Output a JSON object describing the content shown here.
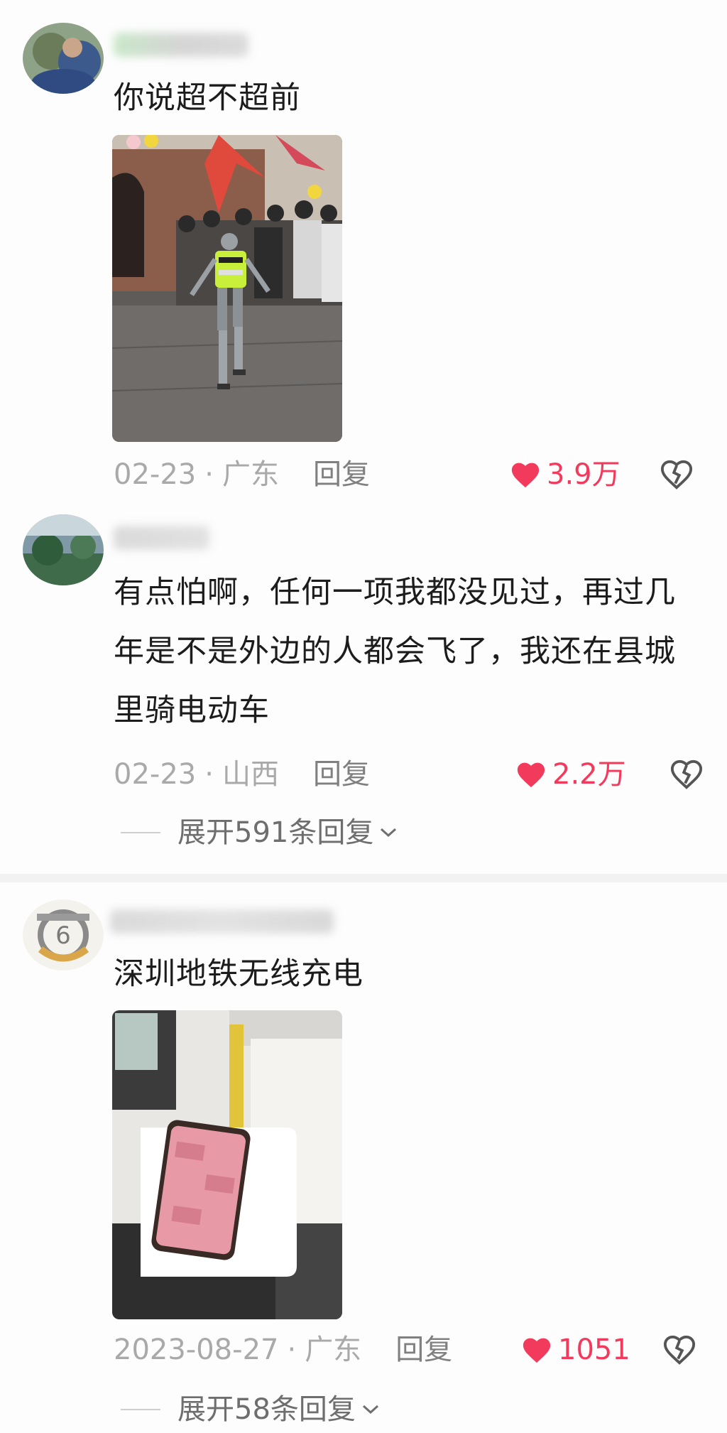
{
  "comments": [
    {
      "text": "你说超不超前",
      "date": "02-23",
      "location": "广东",
      "reply_label": "回复",
      "likes": "3.9万",
      "photo_desc_icon": "photo-robot-police"
    },
    {
      "text": "有点怕啊，任何一项我都没见过，再过几年是不是外边的人都会飞了，我还在县城里骑电动车",
      "date": "02-23",
      "location": "山西",
      "reply_label": "回复",
      "likes": "2.2万",
      "expand_label": "展开591条回复"
    },
    {
      "text": "深圳地铁无线充电",
      "date": "2023-08-27",
      "location": "广东",
      "reply_label": "回复",
      "likes": "1051",
      "expand_label": "展开58条回复",
      "photo_desc_icon": "photo-subway-phone"
    }
  ],
  "separator": "·",
  "colors": {
    "like_red": "#f23b5c",
    "meta_gray": "#a9a9a9"
  }
}
